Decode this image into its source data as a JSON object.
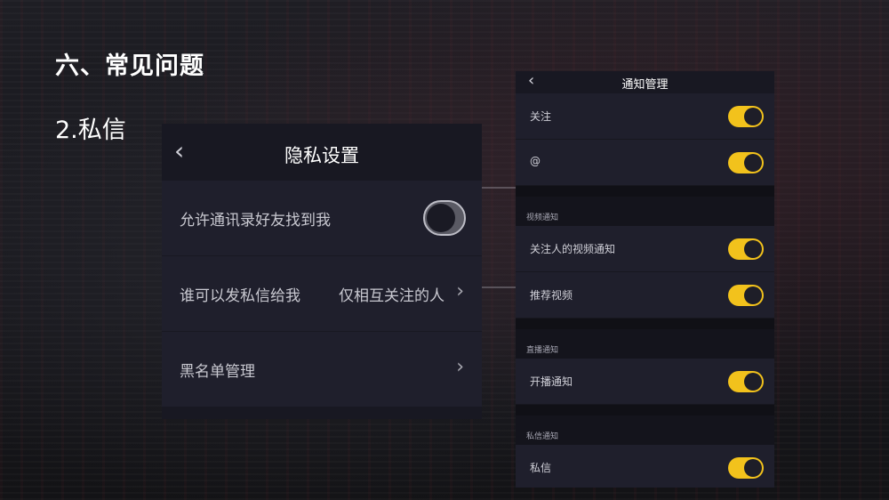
{
  "slide": {
    "title": "六、常见问题",
    "subtitle": "2.私信"
  },
  "privacy_screen": {
    "back_icon": "‹",
    "title": "隐私设置",
    "rows": [
      {
        "label": "允许通讯录好友找到我",
        "control": "toggle",
        "state": "off"
      },
      {
        "label": "谁可以发私信给我",
        "value": "仅相互关注的人",
        "control": "chevron"
      },
      {
        "label": "黑名单管理",
        "control": "chevron"
      }
    ],
    "chevron": "›"
  },
  "notify_screen": {
    "back_icon": "‹",
    "title": "通知管理",
    "rows_top": [
      {
        "label": "关注",
        "state": "on"
      },
      {
        "label": "@",
        "state": "on"
      }
    ],
    "sections": [
      {
        "header": "视频通知",
        "rows": [
          {
            "label": "关注人的视频通知",
            "state": "on"
          },
          {
            "label": "推荐视频",
            "state": "on"
          }
        ]
      },
      {
        "header": "直播通知",
        "rows": [
          {
            "label": "开播通知",
            "state": "on"
          }
        ]
      },
      {
        "header": "私信通知",
        "rows": [
          {
            "label": "私信",
            "state": "on"
          }
        ]
      }
    ]
  },
  "colors": {
    "toggle_on": "#f2c21c",
    "panel_bg": "#1f1f2c",
    "nav_bg": "#181822"
  }
}
